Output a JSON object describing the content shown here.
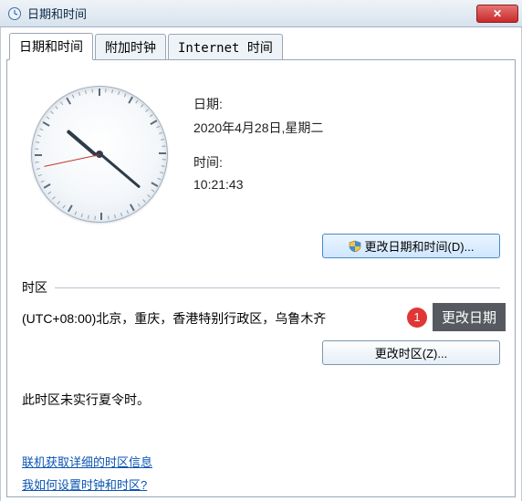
{
  "window": {
    "title": "日期和时间"
  },
  "tabs": [
    {
      "label": "日期和时间",
      "active": true
    },
    {
      "label": "附加时钟",
      "active": false
    },
    {
      "label": "Internet 时间",
      "active": false
    }
  ],
  "datetime": {
    "date_label": "日期:",
    "date_value": "2020年4月28日,星期二",
    "time_label": "时间:",
    "time_value": "10:21:43",
    "clock": {
      "hour": 10,
      "minute": 21,
      "second": 43
    }
  },
  "buttons": {
    "change_datetime": "更改日期和时间(D)...",
    "change_timezone": "更改时区(Z)..."
  },
  "timezone": {
    "section_label": "时区",
    "value": "(UTC+08:00)北京，重庆，香港特别行政区，乌鲁木齐",
    "dst_note": "此时区未实行夏令时。"
  },
  "links": {
    "detailed_tz": "联机获取详细的时区信息",
    "how_to_set": "我如何设置时钟和时区?"
  },
  "callout": {
    "number": "1",
    "text": "更改日期"
  }
}
